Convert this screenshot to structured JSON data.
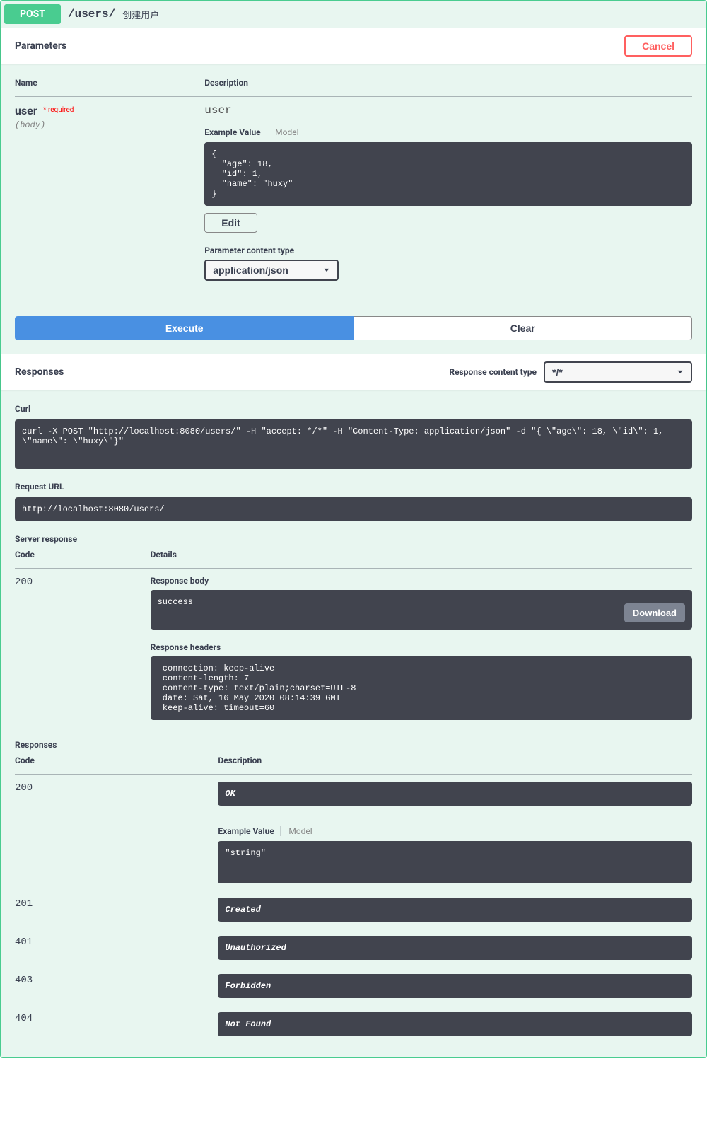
{
  "summary": {
    "method": "POST",
    "path": "/users/",
    "desc": "创建用户"
  },
  "parameters": {
    "title": "Parameters",
    "cancel": "Cancel",
    "columns": {
      "name": "Name",
      "desc": "Description"
    },
    "param": {
      "name": "user",
      "required_label": "* required",
      "in": "(body)",
      "desc": "user",
      "tabs": {
        "example": "Example Value",
        "model": "Model"
      },
      "example_json": "{\n  \"age\": 18,\n  \"id\": 1,\n  \"name\": \"huxy\"\n}",
      "edit_label": "Edit",
      "pct_label": "Parameter content type",
      "pct_value": "application/json"
    }
  },
  "actions": {
    "execute": "Execute",
    "clear": "Clear"
  },
  "responses_section": {
    "title": "Responses",
    "rct_label": "Response content type",
    "rct_value": "*/*"
  },
  "request": {
    "curl_title": "Curl",
    "curl_cmd": "curl -X POST \"http://localhost:8080/users/\" -H \"accept: */*\" -H \"Content-Type: application/json\" -d \"{ \\\"age\\\": 18, \\\"id\\\": 1, \\\"name\\\": \\\"huxy\\\"}\"",
    "req_url_title": "Request URL",
    "req_url": "http://localhost:8080/users/"
  },
  "server_response": {
    "title": "Server response",
    "columns": {
      "code": "Code",
      "details": "Details"
    },
    "code": "200",
    "body_title": "Response body",
    "body": "success",
    "download": "Download",
    "headers_title": "Response headers",
    "headers": " connection: keep-alive \n content-length: 7 \n content-type: text/plain;charset=UTF-8 \n date: Sat, 16 May 2020 08:14:39 GMT \n keep-alive: timeout=60 "
  },
  "documented_responses": {
    "title": "Responses",
    "columns": {
      "code": "Code",
      "desc": "Description"
    },
    "rows": [
      {
        "code": "200",
        "desc": "OK",
        "example_tabs": {
          "example": "Example Value",
          "model": "Model"
        },
        "example": "\"string\""
      },
      {
        "code": "201",
        "desc": "Created"
      },
      {
        "code": "401",
        "desc": "Unauthorized"
      },
      {
        "code": "403",
        "desc": "Forbidden"
      },
      {
        "code": "404",
        "desc": "Not Found"
      }
    ]
  }
}
